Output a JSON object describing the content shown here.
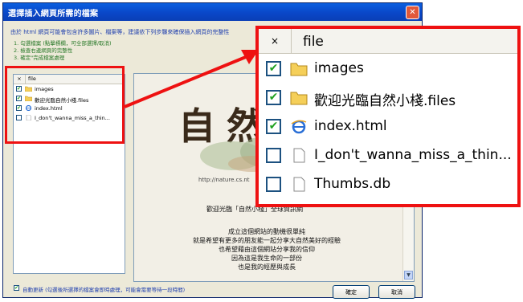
{
  "dialog": {
    "title": "選擇插入網頁所需的檔案",
    "close_label": "✕",
    "intro": "由於 html 網頁可能會包含許多圖片、檔案等，建議依下列步驟來確保插入網頁的完整性",
    "steps": [
      "1. 勾選檔案 (點擊標欄，可全部選擇/取消)",
      "2. 檢查右邊網頁的完整性",
      "3. 確定\"完成檔案處理"
    ]
  },
  "file_list": {
    "header_check": "×",
    "header_file": "file",
    "items": [
      {
        "name": "images",
        "checked": true,
        "icon": "folder-icon"
      },
      {
        "name": "歡迎光臨自然小棧.files",
        "checked": true,
        "icon": "folder-icon"
      },
      {
        "name": "index.html",
        "checked": true,
        "icon": "ie-html-icon"
      },
      {
        "name": "I_don't_wanna_miss_a_thin...",
        "checked": false,
        "icon": "blank-file-icon"
      }
    ]
  },
  "preview": {
    "banner": "自然",
    "url": "http://nature.cs.nt",
    "welcome": "歡迎光臨「自然小棧」全球資訊網",
    "poem": [
      "成立這個網站的動機很單純",
      "就是希望有更多的朋友能一起分享大自然美好的經驗",
      "也希望藉由這個網站分享我的信仰",
      "因為這是我生命的一部份",
      "也是我的經歷與成長"
    ]
  },
  "footer": {
    "auto_update": "自動更新 (勾選後所選擇的檔案會即時處理，可能會需要等待一段時間)",
    "ok": "確定",
    "cancel": "取消"
  },
  "zoom": {
    "header_check": "×",
    "header_file": "file",
    "items": [
      {
        "name": "images",
        "checked": true,
        "icon": "folder-icon"
      },
      {
        "name": "歡迎光臨自然小棧.files",
        "checked": true,
        "icon": "folder-icon"
      },
      {
        "name": "index.html",
        "checked": true,
        "icon": "ie-html-icon"
      },
      {
        "name": "I_don't_wanna_miss_a_thin...",
        "checked": false,
        "icon": "blank-file-icon"
      },
      {
        "name": "Thumbs.db",
        "checked": false,
        "icon": "blank-file-icon"
      }
    ]
  },
  "colors": {
    "highlight": "#ee1111",
    "titlebar": "#0a47c8",
    "check": "#21a121"
  }
}
